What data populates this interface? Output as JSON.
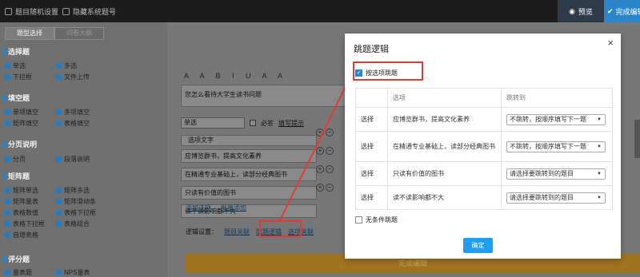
{
  "topbar": {
    "design_label": "题目随机设置",
    "hide_label": "隐藏系统题号",
    "preview_label": "预览",
    "finish_label": "完成编辑"
  },
  "sidebar": {
    "tabs": [
      "题型选择",
      "问卷大纲"
    ],
    "categories": [
      {
        "title": "选择题",
        "items": [
          "单选",
          "多选",
          "下拉框",
          "文件上传"
        ]
      },
      {
        "title": "填空题",
        "items": [
          "单项填空",
          "多项填空",
          "矩阵填空",
          "表格填空"
        ]
      },
      {
        "title": "分页说明",
        "items": [
          "分页",
          "段落说明"
        ]
      },
      {
        "title": "矩阵题",
        "items": [
          "矩阵单选",
          "矩阵多选",
          "矩阵量表",
          "矩阵滑动条",
          "表格数值",
          "表格下拉框",
          "表格下拉框",
          "表格组合",
          "自增表格"
        ]
      },
      {
        "title": "评分题",
        "items": [
          "量表题",
          "NPS量表"
        ]
      }
    ]
  },
  "editor": {
    "toolbar": "A A B I U A A",
    "question_text": "您怎么看待大学生读书问题",
    "type_select": "单选",
    "required_label": "必答",
    "hint_label": "填写提示",
    "options_header": "选项文字",
    "options": [
      "应博览群书，提高文化素养",
      "在精通专业基础上，读部分经典图书",
      "只读有价值的图书",
      "读不读影响都不大"
    ],
    "add_single": "添加选项",
    "add_batch": "批量添加",
    "logic_label": "逻辑设置：",
    "logic_links": [
      "题目关联",
      "跳题逻辑",
      "选项关联"
    ],
    "finish_bar": "完成编辑"
  },
  "modal": {
    "title": "跳题逻辑",
    "close": "×",
    "by_option_label": "按选项跳题",
    "headers": [
      "",
      "选项",
      "跳转到"
    ],
    "rows": [
      {
        "action": "选择",
        "option": "应博览群书，提高文化素养",
        "target": "不跳转，按顺序填写下一题"
      },
      {
        "action": "选择",
        "option": "在精通专业基础上，读部分经典图书",
        "target": "不跳转，按顺序填写下一题"
      },
      {
        "action": "选择",
        "option": "只读有价值的图书",
        "target": "请选择要跳转到的题目"
      },
      {
        "action": "选择",
        "option": "读不读影响都不大",
        "target": "请选择要跳转到的题目"
      }
    ],
    "unconditional_label": "无条件跳题",
    "confirm_label": "确定"
  },
  "colors": {
    "accent": "#1e9df2",
    "highlight": "#e23b34",
    "topbar": "#1c1c1c"
  }
}
